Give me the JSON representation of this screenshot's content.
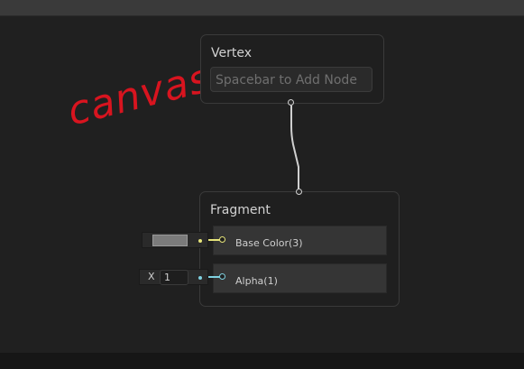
{
  "annotation": {
    "text": "canvas"
  },
  "vertex_node": {
    "title": "Vertex",
    "search_placeholder": "Spacebar to Add Node"
  },
  "fragment_node": {
    "title": "Fragment",
    "ports": [
      {
        "label": "Base Color(3)",
        "port_color": "#e6e47a",
        "input": {
          "type": "color",
          "value": "#7b7b7b"
        }
      },
      {
        "label": "Alpha(1)",
        "port_color": "#7fd1e0",
        "input": {
          "type": "float",
          "axis_label": "X",
          "value": "1"
        }
      }
    ]
  },
  "colors": {
    "annotation": "#d8141f",
    "wire": "#d0d0d0"
  }
}
